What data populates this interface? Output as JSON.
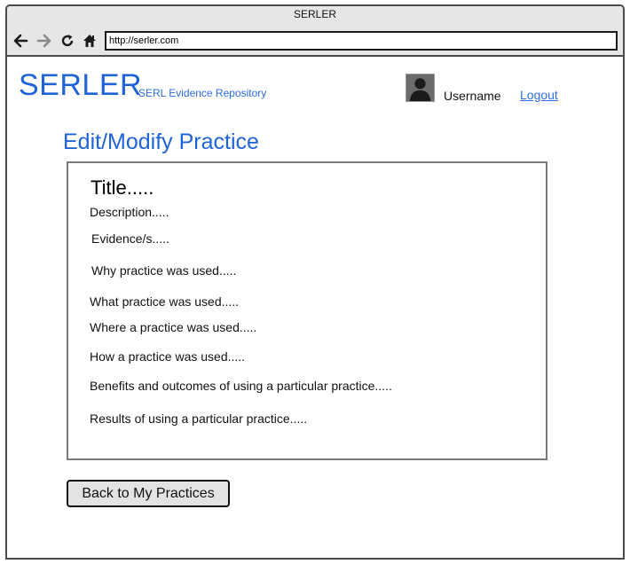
{
  "browser": {
    "window_title": "SERLER",
    "url": "http://serler.com"
  },
  "header": {
    "logo": "SERLER",
    "tagline": "SERL Evidence Repository",
    "username": "Username",
    "logout_label": "Logout"
  },
  "main": {
    "page_title": "Edit/Modify Practice",
    "practice": {
      "title": "Title.....",
      "fields": [
        "Description.....",
        "Evidence/s.....",
        "Why practice was used.....",
        "What practice was used.....",
        "Where a practice was used.....",
        "How a practice was used.....",
        "Benefits and outcomes of using a particular practice.....",
        "Results of using a particular practice....."
      ]
    },
    "back_button_label": "Back to My Practices"
  },
  "icons": {
    "back": "arrow-left-icon",
    "forward": "arrow-right-icon",
    "reload": "reload-icon",
    "home": "home-icon",
    "avatar": "user-avatar-icon"
  },
  "colors": {
    "brand": "#1f63d8",
    "link": "#2d6de0",
    "chrome": "#e6e6e6"
  }
}
